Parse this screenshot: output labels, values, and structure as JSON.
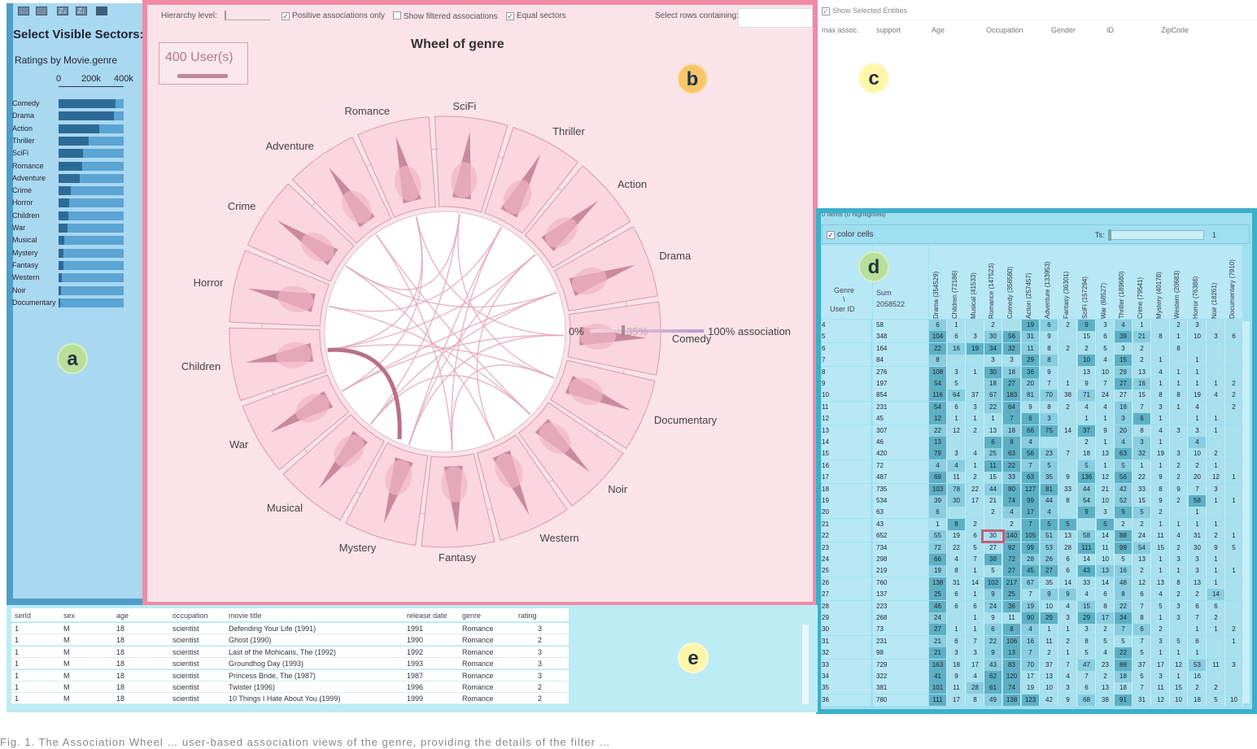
{
  "panel_a": {
    "title": "Select Visible Sectors:",
    "rating_title": "Ratings by Movie.genre",
    "axis": [
      "0",
      "200k",
      "400k"
    ],
    "label": "a",
    "genres": [
      {
        "name": "Comedy",
        "value": 0.88
      },
      {
        "name": "Drama",
        "value": 0.85
      },
      {
        "name": "Action",
        "value": 0.62
      },
      {
        "name": "Thriller",
        "value": 0.46
      },
      {
        "name": "SciFi",
        "value": 0.38
      },
      {
        "name": "Romance",
        "value": 0.36
      },
      {
        "name": "Adventure",
        "value": 0.33
      },
      {
        "name": "Crime",
        "value": 0.19
      },
      {
        "name": "Horror",
        "value": 0.16
      },
      {
        "name": "Children",
        "value": 0.15
      },
      {
        "name": "War",
        "value": 0.14
      },
      {
        "name": "Musical",
        "value": 0.09
      },
      {
        "name": "Mystery",
        "value": 0.08
      },
      {
        "name": "Fantasy",
        "value": 0.07
      },
      {
        "name": "Western",
        "value": 0.05
      },
      {
        "name": "Noir",
        "value": 0.04
      },
      {
        "name": "Documentary",
        "value": 0.02
      }
    ]
  },
  "panel_b": {
    "label": "b",
    "hierarchy_label": "Hierarchy level:",
    "positive_only": "Positive associations only",
    "show_filtered": "Show filtered associations",
    "equal_sectors": "Equal sectors",
    "select_rows": "Select rows containing:",
    "title": "Wheel of genre",
    "users": "400 User(s)",
    "assoc_left": "0%",
    "assoc_mid": "35%",
    "assoc_right": "100% association",
    "sectors": [
      "SciFi",
      "Thriller",
      "Action",
      "Drama",
      "Comedy",
      "Documentary",
      "Noir",
      "Western",
      "Fantasy",
      "Mystery",
      "Musical",
      "War",
      "Children",
      "Horror",
      "Crime",
      "Adventure",
      "Romance"
    ]
  },
  "panel_c": {
    "label": "c",
    "show_selected": "Show Selected Entities",
    "headers": [
      "max assoc.",
      "support",
      "Age",
      "Occupation",
      "Gender",
      "ID",
      "ZipCode"
    ]
  },
  "panel_d": {
    "label": "d",
    "items_text": "0 items (0 highlighted)",
    "color_cells": "color cells",
    "ts_label": "Ts:",
    "ts_value": "1",
    "corner_top": "Genre",
    "corner_bottom": "User ID",
    "sum_label": "Sum",
    "sum_value": "2058522",
    "columns": [
      "Drama (354529)",
      "Children (72186)",
      "Musical (41533)",
      "Romance (147523)",
      "Comedy (356580)",
      "Action (257457)",
      "Adventure (133953)",
      "Fantasy (36301)",
      "SciFi (157294)",
      "War (68527)",
      "Thriller (189680)",
      "Crime (79541)",
      "Mystery (40178)",
      "Western (20683)",
      "Horror (76386)",
      "Noir (18261)",
      "Documentary (7910)"
    ],
    "rows": [
      [
        "4",
        "58",
        "6",
        "1",
        "",
        "2",
        "",
        "19",
        "6",
        "2",
        "9",
        "3",
        "4",
        "1",
        "",
        "2",
        "3",
        "",
        ""
      ],
      [
        "5",
        "348",
        "104",
        "6",
        "3",
        "30",
        "56",
        "31",
        "9",
        "",
        "15",
        "6",
        "39",
        "21",
        "8",
        "1",
        "10",
        "3",
        "6"
      ],
      [
        "6",
        "164",
        "22",
        "16",
        "19",
        "34",
        "32",
        "11",
        "8",
        "2",
        "2",
        "5",
        "3",
        "2",
        "",
        "8",
        "",
        "",
        ""
      ],
      [
        "7",
        "84",
        "8",
        "",
        "",
        "3",
        "3",
        "29",
        "8",
        "",
        "10",
        "4",
        "15",
        "2",
        "1",
        "",
        "1",
        "",
        ""
      ],
      [
        "8",
        "276",
        "108",
        "3",
        "1",
        "30",
        "18",
        "36",
        "9",
        "",
        "13",
        "10",
        "29",
        "13",
        "4",
        "1",
        "1",
        "",
        ""
      ],
      [
        "9",
        "197",
        "54",
        "5",
        "",
        "18",
        "27",
        "20",
        "7",
        "1",
        "9",
        "7",
        "27",
        "16",
        "1",
        "1",
        "1",
        "1",
        "2"
      ],
      [
        "10",
        "854",
        "116",
        "64",
        "37",
        "67",
        "183",
        "81",
        "70",
        "38",
        "71",
        "24",
        "27",
        "15",
        "8",
        "8",
        "19",
        "4",
        "2"
      ],
      [
        "11",
        "231",
        "54",
        "6",
        "3",
        "22",
        "64",
        "9",
        "8",
        "2",
        "4",
        "4",
        "18",
        "7",
        "3",
        "1",
        "4",
        "",
        "2"
      ],
      [
        "12",
        "45",
        "12",
        "1",
        "1",
        "1",
        "7",
        "6",
        "3",
        "",
        "1",
        "1",
        "3",
        "6",
        "1",
        "",
        "1",
        "1",
        ""
      ],
      [
        "13",
        "307",
        "22",
        "12",
        "2",
        "13",
        "18",
        "66",
        "75",
        "14",
        "37",
        "9",
        "20",
        "8",
        "4",
        "3",
        "3",
        "1",
        ""
      ],
      [
        "14",
        "46",
        "13",
        "",
        "",
        "6",
        "8",
        "4",
        "",
        "",
        "2",
        "1",
        "4",
        "3",
        "1",
        "",
        "4",
        "",
        ""
      ],
      [
        "15",
        "420",
        "79",
        "3",
        "4",
        "25",
        "63",
        "56",
        "23",
        "7",
        "18",
        "13",
        "63",
        "32",
        "19",
        "3",
        "10",
        "2",
        ""
      ],
      [
        "16",
        "72",
        "4",
        "4",
        "1",
        "11",
        "22",
        "7",
        "5",
        "",
        "5",
        "1",
        "5",
        "1",
        "1",
        "2",
        "2",
        "1",
        ""
      ],
      [
        "17",
        "487",
        "69",
        "11",
        "2",
        "15",
        "33",
        "63",
        "35",
        "9",
        "136",
        "12",
        "56",
        "22",
        "9",
        "2",
        "20",
        "12",
        "1"
      ],
      [
        "18",
        "735",
        "103",
        "78",
        "22",
        "44",
        "80",
        "127",
        "81",
        "33",
        "44",
        "21",
        "42",
        "33",
        "8",
        "9",
        "7",
        "3",
        ""
      ],
      [
        "19",
        "534",
        "39",
        "30",
        "17",
        "21",
        "74",
        "99",
        "44",
        "8",
        "54",
        "10",
        "52",
        "15",
        "9",
        "2",
        "58",
        "1",
        "1"
      ],
      [
        "20",
        "63",
        "6",
        "",
        "",
        "2",
        "4",
        "17",
        "4",
        "",
        "9",
        "3",
        "9",
        "5",
        "2",
        "",
        "1",
        "",
        ""
      ],
      [
        "21",
        "43",
        "1",
        "8",
        "2",
        "",
        "2",
        "7",
        "5",
        "5",
        "",
        "5",
        "2",
        "2",
        "1",
        "1",
        "1",
        "1",
        ""
      ],
      [
        "22",
        "652",
        "55",
        "19",
        "6",
        "30",
        "140",
        "105",
        "51",
        "13",
        "58",
        "14",
        "88",
        "24",
        "11",
        "4",
        "31",
        "2",
        "1"
      ],
      [
        "23",
        "734",
        "72",
        "22",
        "5",
        "27",
        "92",
        "99",
        "53",
        "28",
        "111",
        "11",
        "99",
        "54",
        "15",
        "2",
        "30",
        "9",
        "5"
      ],
      [
        "24",
        "298",
        "66",
        "4",
        "7",
        "38",
        "72",
        "28",
        "26",
        "6",
        "14",
        "10",
        "5",
        "13",
        "1",
        "3",
        "3",
        "1",
        ""
      ],
      [
        "25",
        "219",
        "19",
        "8",
        "1",
        "5",
        "27",
        "45",
        "27",
        "6",
        "43",
        "13",
        "16",
        "2",
        "1",
        "1",
        "3",
        "1",
        "1"
      ],
      [
        "26",
        "760",
        "138",
        "31",
        "14",
        "102",
        "217",
        "67",
        "35",
        "14",
        "33",
        "14",
        "48",
        "12",
        "13",
        "8",
        "13",
        "1",
        ""
      ],
      [
        "27",
        "137",
        "25",
        "6",
        "1",
        "9",
        "25",
        "7",
        "9",
        "9",
        "4",
        "6",
        "8",
        "6",
        "4",
        "2",
        "2",
        "14",
        ""
      ],
      [
        "28",
        "223",
        "46",
        "6",
        "6",
        "24",
        "36",
        "19",
        "10",
        "4",
        "15",
        "8",
        "22",
        "7",
        "5",
        "3",
        "6",
        "6",
        ""
      ],
      [
        "29",
        "268",
        "24",
        "",
        "1",
        "9",
        "11",
        "90",
        "29",
        "3",
        "29",
        "17",
        "34",
        "8",
        "1",
        "3",
        "7",
        "2",
        ""
      ],
      [
        "30",
        "73",
        "27",
        "1",
        "1",
        "6",
        "8",
        "4",
        "1",
        "1",
        "3",
        "2",
        "7",
        "6",
        "2",
        "",
        "1",
        "1",
        "2"
      ],
      [
        "31",
        "231",
        "21",
        "6",
        "7",
        "22",
        "106",
        "16",
        "11",
        "2",
        "8",
        "5",
        "5",
        "7",
        "3",
        "5",
        "6",
        "",
        "1"
      ],
      [
        "32",
        "98",
        "21",
        "3",
        "3",
        "9",
        "13",
        "7",
        "2",
        "1",
        "5",
        "4",
        "22",
        "5",
        "1",
        "1",
        "1",
        "",
        ""
      ],
      [
        "33",
        "729",
        "163",
        "18",
        "17",
        "43",
        "83",
        "70",
        "37",
        "7",
        "47",
        "23",
        "88",
        "37",
        "17",
        "12",
        "53",
        "11",
        "3"
      ],
      [
        "34",
        "322",
        "41",
        "9",
        "4",
        "62",
        "120",
        "17",
        "13",
        "4",
        "7",
        "2",
        "18",
        "5",
        "3",
        "1",
        "16",
        "",
        ""
      ],
      [
        "35",
        "381",
        "101",
        "11",
        "28",
        "61",
        "74",
        "19",
        "10",
        "3",
        "6",
        "13",
        "18",
        "7",
        "11",
        "15",
        "2",
        "2",
        ""
      ],
      [
        "36",
        "780",
        "111",
        "17",
        "8",
        "49",
        "138",
        "123",
        "42",
        "9",
        "68",
        "38",
        "91",
        "31",
        "12",
        "10",
        "18",
        "5",
        "10"
      ]
    ]
  },
  "panel_e": {
    "label": "e",
    "headers": [
      "serId",
      "sex",
      "age",
      "occupation",
      "movie title",
      "release date",
      "genre",
      "rating"
    ],
    "rows": [
      [
        "1",
        "M",
        "18",
        "scientist",
        "Defending Your Life (1991)",
        "1991",
        "Romance",
        "3"
      ],
      [
        "1",
        "M",
        "18",
        "scientist",
        "Ghost (1990)",
        "1990",
        "Romance",
        "2"
      ],
      [
        "1",
        "M",
        "18",
        "scientist",
        "Last of the Mohicans, The (1992)",
        "1992",
        "Romance",
        "3"
      ],
      [
        "1",
        "M",
        "18",
        "scientist",
        "Groundhog Day (1993)",
        "1993",
        "Romance",
        "3"
      ],
      [
        "1",
        "M",
        "18",
        "scientist",
        "Princess Bride, The (1987)",
        "1987",
        "Romance",
        "3"
      ],
      [
        "1",
        "M",
        "18",
        "scientist",
        "Twister (1996)",
        "1996",
        "Romance",
        "2"
      ],
      [
        "1",
        "M",
        "18",
        "scientist",
        "10 Things I Hate About You (1999)",
        "1999",
        "Romance",
        "2"
      ]
    ]
  },
  "caption": "Fig. 1.  The Association Wheel … user-based association views of the genre, providing the details of the filter …"
}
